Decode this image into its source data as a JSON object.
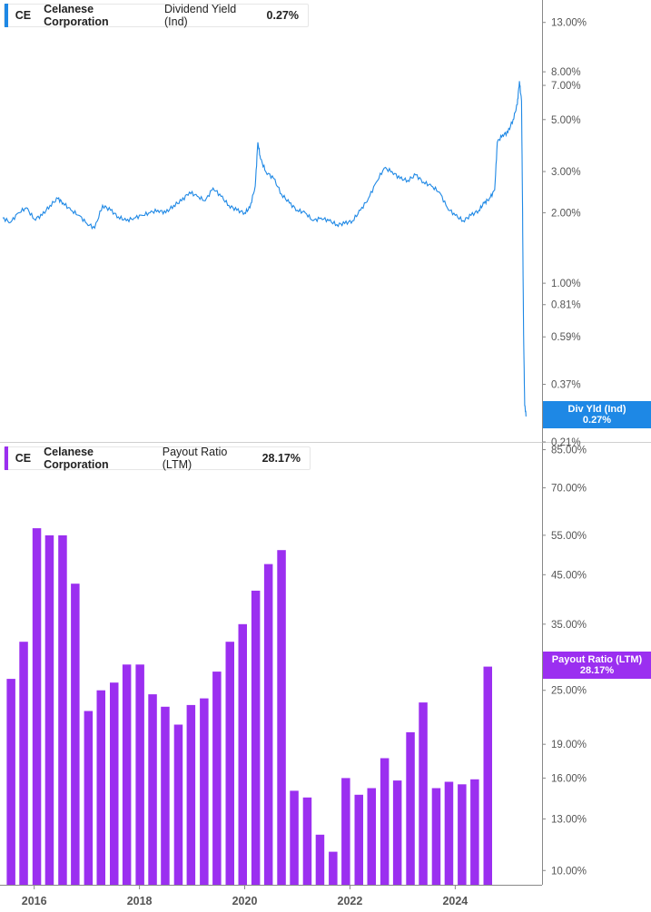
{
  "colors": {
    "yield_line": "#1e88e5",
    "payout_bar": "#9b2ff0"
  },
  "top_legend": {
    "ticker": "CE",
    "company": "Celanese Corporation",
    "metric": "Dividend Yield (Ind)",
    "value": "0.27%"
  },
  "bottom_legend": {
    "ticker": "CE",
    "company": "Celanese Corporation",
    "metric": "Payout Ratio (LTM)",
    "value": "28.17%"
  },
  "top_badge": {
    "label": "Div Yld (Ind)",
    "value": "0.27%"
  },
  "bottom_badge": {
    "label": "Payout Ratio (LTM)",
    "value": "28.17%"
  },
  "x_labels": [
    "2016",
    "2018",
    "2020",
    "2022",
    "2024"
  ],
  "chart_data": [
    {
      "type": "line",
      "scale": "log",
      "series": [
        {
          "values": [
            [
              2015.4,
              1.9
            ],
            [
              2015.55,
              1.82
            ],
            [
              2015.7,
              2.0
            ],
            [
              2015.85,
              2.1
            ],
            [
              2016.0,
              1.88
            ],
            [
              2016.15,
              1.95
            ],
            [
              2016.3,
              2.15
            ],
            [
              2016.45,
              2.3
            ],
            [
              2016.55,
              2.2
            ],
            [
              2016.7,
              2.05
            ],
            [
              2016.85,
              1.95
            ],
            [
              2017.0,
              1.8
            ],
            [
              2017.15,
              1.72
            ],
            [
              2017.3,
              2.15
            ],
            [
              2017.45,
              2.05
            ],
            [
              2017.6,
              1.92
            ],
            [
              2017.75,
              1.85
            ],
            [
              2017.9,
              1.9
            ],
            [
              2018.05,
              1.95
            ],
            [
              2018.2,
              2.0
            ],
            [
              2018.35,
              2.05
            ],
            [
              2018.5,
              2.0
            ],
            [
              2018.65,
              2.15
            ],
            [
              2018.8,
              2.25
            ],
            [
              2018.95,
              2.45
            ],
            [
              2019.1,
              2.35
            ],
            [
              2019.25,
              2.25
            ],
            [
              2019.4,
              2.55
            ],
            [
              2019.55,
              2.35
            ],
            [
              2019.7,
              2.15
            ],
            [
              2019.85,
              2.05
            ],
            [
              2020.0,
              2.0
            ],
            [
              2020.1,
              2.1
            ],
            [
              2020.2,
              2.6
            ],
            [
              2020.25,
              4.0
            ],
            [
              2020.3,
              3.4
            ],
            [
              2020.4,
              3.0
            ],
            [
              2020.55,
              2.8
            ],
            [
              2020.7,
              2.4
            ],
            [
              2020.85,
              2.2
            ],
            [
              2021.0,
              2.05
            ],
            [
              2021.15,
              2.0
            ],
            [
              2021.3,
              1.85
            ],
            [
              2021.45,
              1.9
            ],
            [
              2021.6,
              1.85
            ],
            [
              2021.75,
              1.78
            ],
            [
              2021.9,
              1.8
            ],
            [
              2022.05,
              1.85
            ],
            [
              2022.2,
              2.05
            ],
            [
              2022.35,
              2.3
            ],
            [
              2022.5,
              2.7
            ],
            [
              2022.65,
              3.1
            ],
            [
              2022.8,
              3.0
            ],
            [
              2022.95,
              2.8
            ],
            [
              2023.1,
              2.75
            ],
            [
              2023.25,
              2.9
            ],
            [
              2023.4,
              2.7
            ],
            [
              2023.55,
              2.6
            ],
            [
              2023.7,
              2.45
            ],
            [
              2023.85,
              2.1
            ],
            [
              2024.0,
              1.95
            ],
            [
              2024.15,
              1.85
            ],
            [
              2024.3,
              1.95
            ],
            [
              2024.45,
              2.05
            ],
            [
              2024.55,
              2.2
            ],
            [
              2024.65,
              2.3
            ],
            [
              2024.75,
              2.5
            ],
            [
              2024.8,
              4.0
            ],
            [
              2024.9,
              4.3
            ],
            [
              2025.0,
              4.4
            ],
            [
              2025.1,
              5.0
            ],
            [
              2025.18,
              5.8
            ],
            [
              2025.22,
              7.3
            ],
            [
              2025.26,
              6.0
            ],
            [
              2025.28,
              2.0
            ],
            [
              2025.3,
              0.6
            ],
            [
              2025.32,
              0.3
            ],
            [
              2025.35,
              0.27
            ]
          ]
        }
      ],
      "y_ticks": [
        "13.00%",
        "8.00%",
        "7.00%",
        "5.00%",
        "3.00%",
        "2.00%",
        "1.00%",
        "0.81%",
        "0.59%",
        "0.37%",
        "0.30%",
        "0.21%"
      ],
      "ylim": [
        0.21,
        15.5
      ],
      "xlim": [
        2015.35,
        2025.65
      ],
      "grid": false
    },
    {
      "type": "bar",
      "scale": "log",
      "series": [
        {
          "values": [
            [
              2015.56,
              26.5
            ],
            [
              2015.8,
              32.0
            ],
            [
              2016.05,
              57.0
            ],
            [
              2016.29,
              55.0
            ],
            [
              2016.54,
              55.0
            ],
            [
              2016.78,
              43.0
            ],
            [
              2017.03,
              22.5
            ],
            [
              2017.27,
              25.0
            ],
            [
              2017.52,
              26.0
            ],
            [
              2017.76,
              28.5
            ],
            [
              2018.01,
              28.5
            ],
            [
              2018.25,
              24.5
            ],
            [
              2018.49,
              23.0
            ],
            [
              2018.74,
              21.0
            ],
            [
              2018.98,
              23.2
            ],
            [
              2019.23,
              24.0
            ],
            [
              2019.47,
              27.5
            ],
            [
              2019.72,
              32.0
            ],
            [
              2019.96,
              35.0
            ],
            [
              2020.21,
              41.5
            ],
            [
              2020.45,
              47.5
            ],
            [
              2020.7,
              51.0
            ],
            [
              2020.94,
              15.0
            ],
            [
              2021.19,
              14.5
            ],
            [
              2021.43,
              12.0
            ],
            [
              2021.68,
              11.0
            ],
            [
              2021.92,
              16.0
            ],
            [
              2022.17,
              14.7
            ],
            [
              2022.41,
              15.2
            ],
            [
              2022.66,
              17.7
            ],
            [
              2022.9,
              15.8
            ],
            [
              2023.15,
              20.2
            ],
            [
              2023.39,
              23.5
            ],
            [
              2023.64,
              15.2
            ],
            [
              2023.88,
              15.7
            ],
            [
              2024.13,
              15.5
            ],
            [
              2024.37,
              15.9
            ],
            [
              2024.62,
              28.2
            ]
          ]
        }
      ],
      "y_ticks": [
        "85.00%",
        "70.00%",
        "55.00%",
        "45.00%",
        "35.00%",
        "25.00%",
        "19.00%",
        "16.00%",
        "13.00%",
        "10.00%"
      ],
      "ylim": [
        9.3,
        88
      ],
      "xlim": [
        2015.35,
        2025.65
      ],
      "grid": false
    }
  ]
}
